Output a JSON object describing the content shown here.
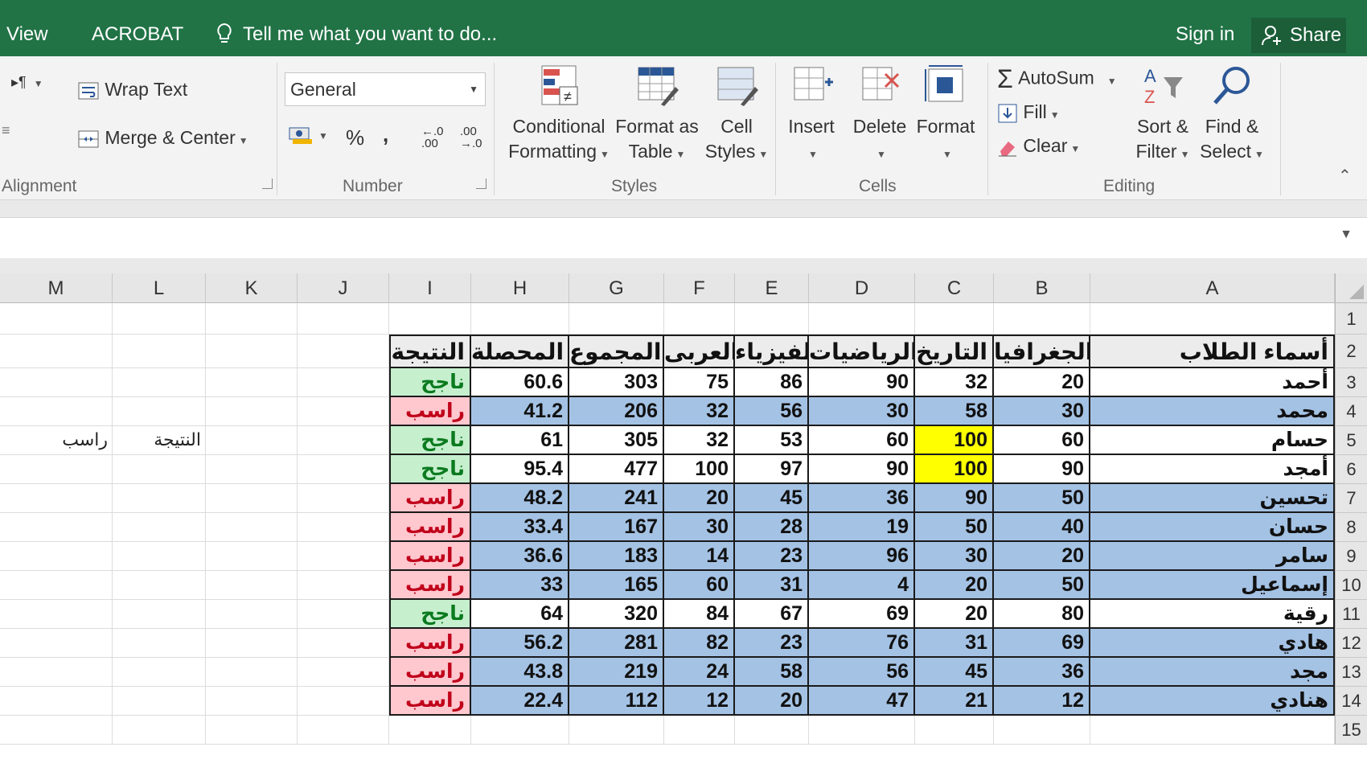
{
  "topbar": {
    "view_tab": "View",
    "acrobat_tab": "ACROBAT",
    "tell_me": "Tell me what you want to do...",
    "sign_in": "Sign in",
    "share": "Share"
  },
  "ribbon": {
    "alignment": {
      "wrap_text": "Wrap Text",
      "merge_center": "Merge & Center",
      "label": "Alignment"
    },
    "number": {
      "format": "General",
      "percent": "%",
      "comma": ",",
      "inc_decimal": "←.0 .00",
      "dec_decimal": ".00 →.0",
      "label": "Number"
    },
    "styles": {
      "conditional_formatting": [
        "Conditional",
        "Formatting"
      ],
      "format_as_table": [
        "Format as",
        "Table"
      ],
      "cell_styles": [
        "Cell",
        "Styles"
      ],
      "label": "Styles"
    },
    "cells": {
      "insert": "Insert",
      "delete": "Delete",
      "format": "Format",
      "label": "Cells"
    },
    "editing": {
      "autosum": "AutoSum",
      "fill": "Fill",
      "clear": "Clear",
      "sort_filter": [
        "Sort &",
        "Filter"
      ],
      "find_select": [
        "Find &",
        "Select"
      ],
      "label": "Editing"
    },
    "icons": {
      "wrap_text": "wrap-text-icon",
      "merge": "merge-center-icon",
      "currency": "currency-icon",
      "conditional": "conditional-formatting-icon",
      "table": "format-table-icon",
      "cell_styles": "cell-styles-icon",
      "insert": "insert-cells-icon",
      "delete": "delete-cells-icon",
      "format": "format-cells-icon",
      "autosum": "sigma-icon",
      "fill": "fill-down-icon",
      "clear": "eraser-icon",
      "sort": "sort-filter-icon",
      "find": "magnifier-icon"
    }
  },
  "grid": {
    "columns": [
      "M",
      "L",
      "K",
      "J",
      "I",
      "H",
      "G",
      "F",
      "E",
      "D",
      "C",
      "B",
      "A"
    ],
    "rows": [
      "1",
      "2",
      "3",
      "4",
      "5",
      "6",
      "7",
      "8",
      "9",
      "10",
      "11",
      "12",
      "13",
      "14",
      "15"
    ],
    "outside_cells": {
      "L5": "النتيجة",
      "M5": "راسب"
    },
    "table": {
      "headers": [
        "أسماء الطلاب",
        "الجغرافيا",
        "التاريخ",
        "الرياضيات",
        "الفيزياء",
        "العربى",
        "المجموع",
        "المحصلة",
        "النتيجة"
      ],
      "rows": [
        [
          "أحمد",
          "20",
          "32",
          "90",
          "86",
          "75",
          "303",
          "60.6",
          "ناجح"
        ],
        [
          "محمد",
          "30",
          "58",
          "30",
          "56",
          "32",
          "206",
          "41.2",
          "راسب"
        ],
        [
          "حسام",
          "60",
          "100",
          "60",
          "53",
          "32",
          "305",
          "61",
          "ناجح"
        ],
        [
          "أمجد",
          "90",
          "100",
          "90",
          "97",
          "100",
          "477",
          "95.4",
          "ناجح"
        ],
        [
          "تحسين",
          "50",
          "90",
          "36",
          "45",
          "20",
          "241",
          "48.2",
          "راسب"
        ],
        [
          "حسان",
          "40",
          "50",
          "19",
          "28",
          "30",
          "167",
          "33.4",
          "راسب"
        ],
        [
          "سامر",
          "20",
          "30",
          "96",
          "23",
          "14",
          "183",
          "36.6",
          "راسب"
        ],
        [
          "إسماعيل",
          "50",
          "20",
          "4",
          "31",
          "60",
          "165",
          "33",
          "راسب"
        ],
        [
          "رقية",
          "80",
          "20",
          "69",
          "67",
          "84",
          "320",
          "64",
          "ناجح"
        ],
        [
          "هادي",
          "69",
          "31",
          "76",
          "23",
          "82",
          "281",
          "56.2",
          "راسب"
        ],
        [
          "مجد",
          "36",
          "45",
          "56",
          "58",
          "24",
          "219",
          "43.8",
          "راسب"
        ],
        [
          "هنادي",
          "12",
          "21",
          "47",
          "20",
          "12",
          "112",
          "22.4",
          "راسب"
        ]
      ],
      "row_fill": [
        "white",
        "blue",
        "white",
        "white",
        "blue",
        "blue",
        "blue",
        "blue",
        "white",
        "blue",
        "blue",
        "blue"
      ],
      "highlight": [
        [
          2,
          2
        ],
        [
          3,
          2
        ]
      ],
      "pass_label": "ناجح",
      "fill_colors": {
        "blue": "#a4c2e4",
        "yellow": "#ffff00",
        "pass_bg": "#c6efce",
        "pass_fg": "#0b7a1f",
        "fail_bg": "#ffc7ce",
        "fail_fg": "#c0001a"
      }
    }
  },
  "colors": {
    "excel_green": "#217346",
    "ribbon_bg": "#f3f3f3"
  }
}
